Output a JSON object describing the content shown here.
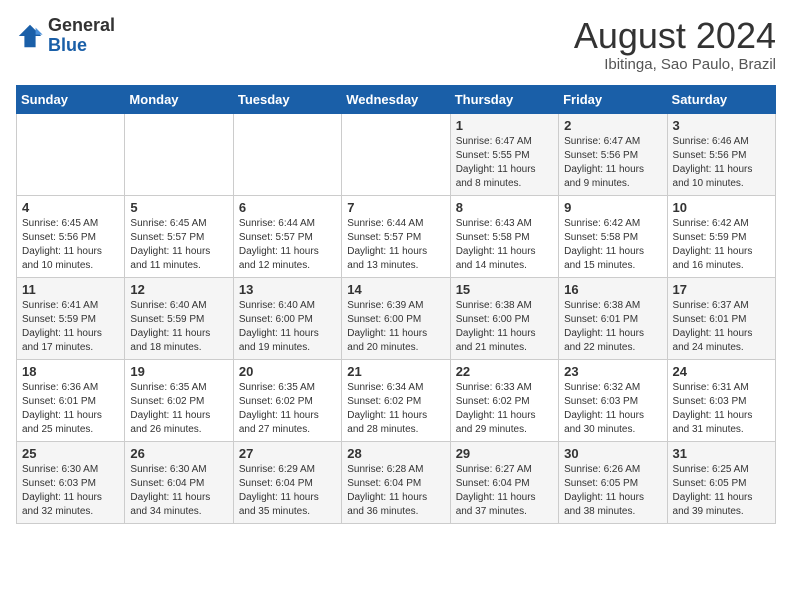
{
  "logo": {
    "general": "General",
    "blue": "Blue"
  },
  "title": {
    "month_year": "August 2024",
    "location": "Ibitinga, Sao Paulo, Brazil"
  },
  "headers": [
    "Sunday",
    "Monday",
    "Tuesday",
    "Wednesday",
    "Thursday",
    "Friday",
    "Saturday"
  ],
  "weeks": [
    [
      {
        "day": "",
        "info": ""
      },
      {
        "day": "",
        "info": ""
      },
      {
        "day": "",
        "info": ""
      },
      {
        "day": "",
        "info": ""
      },
      {
        "day": "1",
        "info": "Sunrise: 6:47 AM\nSunset: 5:55 PM\nDaylight: 11 hours\nand 8 minutes."
      },
      {
        "day": "2",
        "info": "Sunrise: 6:47 AM\nSunset: 5:56 PM\nDaylight: 11 hours\nand 9 minutes."
      },
      {
        "day": "3",
        "info": "Sunrise: 6:46 AM\nSunset: 5:56 PM\nDaylight: 11 hours\nand 10 minutes."
      }
    ],
    [
      {
        "day": "4",
        "info": "Sunrise: 6:45 AM\nSunset: 5:56 PM\nDaylight: 11 hours\nand 10 minutes."
      },
      {
        "day": "5",
        "info": "Sunrise: 6:45 AM\nSunset: 5:57 PM\nDaylight: 11 hours\nand 11 minutes."
      },
      {
        "day": "6",
        "info": "Sunrise: 6:44 AM\nSunset: 5:57 PM\nDaylight: 11 hours\nand 12 minutes."
      },
      {
        "day": "7",
        "info": "Sunrise: 6:44 AM\nSunset: 5:57 PM\nDaylight: 11 hours\nand 13 minutes."
      },
      {
        "day": "8",
        "info": "Sunrise: 6:43 AM\nSunset: 5:58 PM\nDaylight: 11 hours\nand 14 minutes."
      },
      {
        "day": "9",
        "info": "Sunrise: 6:42 AM\nSunset: 5:58 PM\nDaylight: 11 hours\nand 15 minutes."
      },
      {
        "day": "10",
        "info": "Sunrise: 6:42 AM\nSunset: 5:59 PM\nDaylight: 11 hours\nand 16 minutes."
      }
    ],
    [
      {
        "day": "11",
        "info": "Sunrise: 6:41 AM\nSunset: 5:59 PM\nDaylight: 11 hours\nand 17 minutes."
      },
      {
        "day": "12",
        "info": "Sunrise: 6:40 AM\nSunset: 5:59 PM\nDaylight: 11 hours\nand 18 minutes."
      },
      {
        "day": "13",
        "info": "Sunrise: 6:40 AM\nSunset: 6:00 PM\nDaylight: 11 hours\nand 19 minutes."
      },
      {
        "day": "14",
        "info": "Sunrise: 6:39 AM\nSunset: 6:00 PM\nDaylight: 11 hours\nand 20 minutes."
      },
      {
        "day": "15",
        "info": "Sunrise: 6:38 AM\nSunset: 6:00 PM\nDaylight: 11 hours\nand 21 minutes."
      },
      {
        "day": "16",
        "info": "Sunrise: 6:38 AM\nSunset: 6:01 PM\nDaylight: 11 hours\nand 22 minutes."
      },
      {
        "day": "17",
        "info": "Sunrise: 6:37 AM\nSunset: 6:01 PM\nDaylight: 11 hours\nand 24 minutes."
      }
    ],
    [
      {
        "day": "18",
        "info": "Sunrise: 6:36 AM\nSunset: 6:01 PM\nDaylight: 11 hours\nand 25 minutes."
      },
      {
        "day": "19",
        "info": "Sunrise: 6:35 AM\nSunset: 6:02 PM\nDaylight: 11 hours\nand 26 minutes."
      },
      {
        "day": "20",
        "info": "Sunrise: 6:35 AM\nSunset: 6:02 PM\nDaylight: 11 hours\nand 27 minutes."
      },
      {
        "day": "21",
        "info": "Sunrise: 6:34 AM\nSunset: 6:02 PM\nDaylight: 11 hours\nand 28 minutes."
      },
      {
        "day": "22",
        "info": "Sunrise: 6:33 AM\nSunset: 6:02 PM\nDaylight: 11 hours\nand 29 minutes."
      },
      {
        "day": "23",
        "info": "Sunrise: 6:32 AM\nSunset: 6:03 PM\nDaylight: 11 hours\nand 30 minutes."
      },
      {
        "day": "24",
        "info": "Sunrise: 6:31 AM\nSunset: 6:03 PM\nDaylight: 11 hours\nand 31 minutes."
      }
    ],
    [
      {
        "day": "25",
        "info": "Sunrise: 6:30 AM\nSunset: 6:03 PM\nDaylight: 11 hours\nand 32 minutes."
      },
      {
        "day": "26",
        "info": "Sunrise: 6:30 AM\nSunset: 6:04 PM\nDaylight: 11 hours\nand 34 minutes."
      },
      {
        "day": "27",
        "info": "Sunrise: 6:29 AM\nSunset: 6:04 PM\nDaylight: 11 hours\nand 35 minutes."
      },
      {
        "day": "28",
        "info": "Sunrise: 6:28 AM\nSunset: 6:04 PM\nDaylight: 11 hours\nand 36 minutes."
      },
      {
        "day": "29",
        "info": "Sunrise: 6:27 AM\nSunset: 6:04 PM\nDaylight: 11 hours\nand 37 minutes."
      },
      {
        "day": "30",
        "info": "Sunrise: 6:26 AM\nSunset: 6:05 PM\nDaylight: 11 hours\nand 38 minutes."
      },
      {
        "day": "31",
        "info": "Sunrise: 6:25 AM\nSunset: 6:05 PM\nDaylight: 11 hours\nand 39 minutes."
      }
    ]
  ]
}
